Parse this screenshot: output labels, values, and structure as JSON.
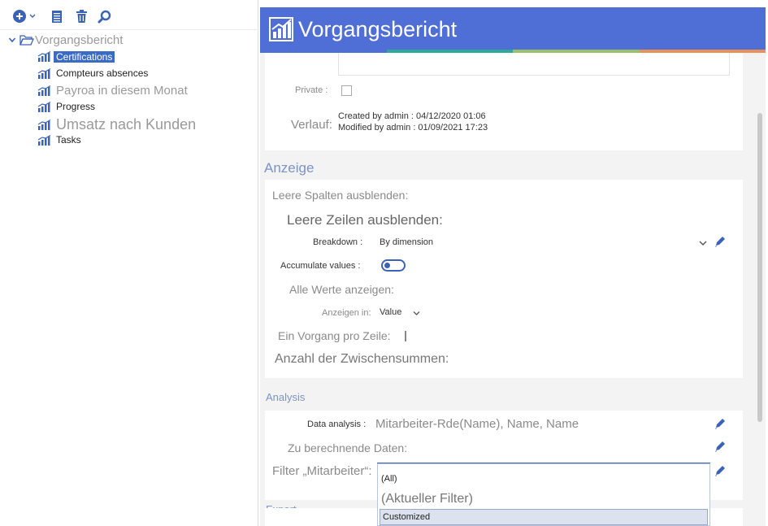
{
  "toolbar": {
    "add_icon": "plus-circle-icon",
    "report_icon": "report-list-icon",
    "delete_icon": "trash-icon",
    "search_icon": "search-icon"
  },
  "tree": {
    "root_label": "Vorgangsbericht",
    "items": [
      {
        "label": "Certifications"
      },
      {
        "label": "Compteurs absences"
      },
      {
        "label": "Payroa in diesem Monat"
      },
      {
        "label": "Progress"
      },
      {
        "label": "Umsatz nach Kunden"
      },
      {
        "label": "Tasks"
      }
    ]
  },
  "header": {
    "title": "Vorgangsbericht",
    "color": "#4f6fd6",
    "strip_colors": [
      "#4f6fd6",
      "#2fa89a",
      "#9bc06a",
      "#e8925a"
    ]
  },
  "info": {
    "private_label": "Private :",
    "history_label": "Verlauf:",
    "created": "Created by admin : 04/12/2020 01:06",
    "modified": "Modified by admin : 01/09/2021 17:23"
  },
  "display": {
    "section_title": "Anzeige",
    "hide_empty_columns": "Leere Spalten ausblenden:",
    "hide_empty_rows": "Leere Zeilen ausblenden:",
    "breakdown_label": "Breakdown :",
    "breakdown_value": "By dimension",
    "accumulate_label": "Accumulate values :",
    "show_all_values": "Alle Werte anzeigen:",
    "show_in_label": "Anzeigen in:",
    "show_in_value": "Value",
    "one_per_row": "Ein Vorgang pro Zeile:",
    "subtotals": "Anzahl der Zwischensummen:"
  },
  "analysis": {
    "section_title": "Analysis",
    "data_analysis_label": "Data analysis :",
    "data_analysis_value": "Mitarbeiter-Rde(Name), Name, Name",
    "computed_data": "Zu berechnende Daten:",
    "filter_label": "Filter „Mitarbeiter“:",
    "options": [
      "(All)",
      "(Aktueller Filter)",
      "Customized"
    ]
  },
  "export": {
    "section_title": "Export"
  }
}
